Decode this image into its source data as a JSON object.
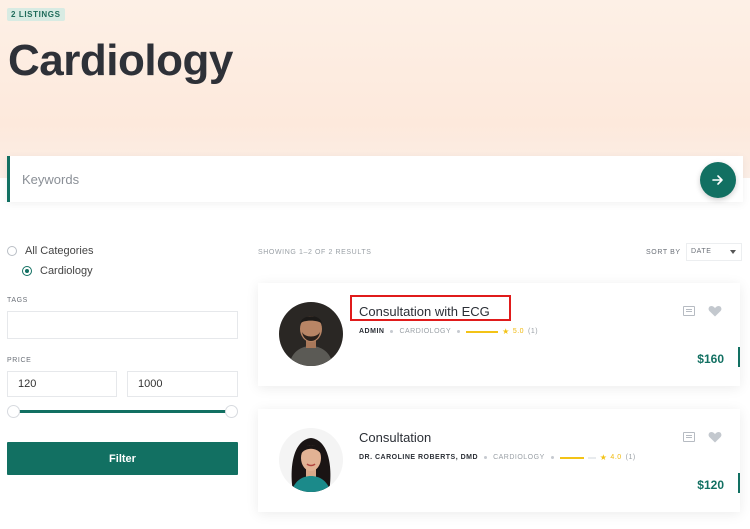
{
  "header": {
    "listings_badge": "2 LISTINGS",
    "title": "Cardiology"
  },
  "search": {
    "placeholder": "Keywords",
    "button_icon": "arrow-right-icon"
  },
  "sidebar": {
    "categories": [
      {
        "label": "All Categories",
        "selected": false
      },
      {
        "label": "Cardiology",
        "selected": true
      }
    ],
    "tags_label": "TAGS",
    "tags_value": "",
    "price_label": "PRICE",
    "price_min": "120",
    "price_max": "1000",
    "price_range_fraction": [
      0.0,
      1.0
    ],
    "filter_label": "Filter"
  },
  "results": {
    "summary": "SHOWING 1–2 OF 2 RESULTS",
    "sort_label": "SORT BY",
    "sort_value": "DATE"
  },
  "listings": [
    {
      "title": "Consultation with ECG",
      "author": "ADMIN",
      "category": "CARDIOLOGY",
      "rating": "5.0",
      "rating_count": "(1)",
      "price": "$160",
      "highlighted": true
    },
    {
      "title": "Consultation",
      "author": "DR. CAROLINE ROBERTS, DMD",
      "category": "CARDIOLOGY",
      "rating": "4.0",
      "rating_count": "(1)",
      "price": "$120",
      "highlighted": false
    }
  ],
  "colors": {
    "accent": "#127062",
    "hero_bg": "#fdece0",
    "star": "#f3c316",
    "highlight_box": "#e01b1b"
  }
}
